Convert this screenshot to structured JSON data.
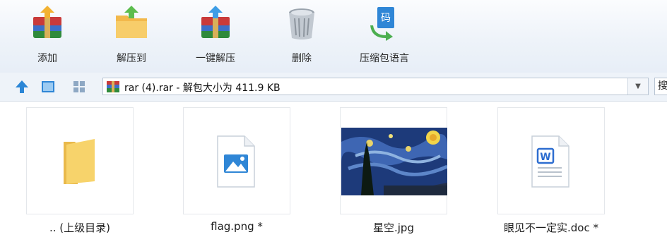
{
  "toolbar": {
    "buttons": [
      {
        "label": "添加",
        "icon": "add-archive-icon"
      },
      {
        "label": "解压到",
        "icon": "extract-folder-icon"
      },
      {
        "label": "一键解压",
        "icon": "one-click-extract-icon"
      },
      {
        "label": "删除",
        "icon": "trash-icon"
      },
      {
        "label": "压缩包语言",
        "icon": "archive-language-icon"
      }
    ]
  },
  "navbar": {
    "path": "rar (4).rar - 解包大小为 411.9 KB",
    "search_partial": "搜"
  },
  "files": [
    {
      "name": ".. (上级目录)",
      "type": "parent-folder"
    },
    {
      "name": "flag.png *",
      "type": "png"
    },
    {
      "name": "星空.jpg",
      "type": "jpg"
    },
    {
      "name": "眼见不一定实.doc *",
      "type": "doc"
    }
  ],
  "colors": {
    "toolbar_bg": "#eef3f9",
    "folder": "#f7d36b",
    "image_icon_blue": "#2f86d6",
    "word_blue": "#2d6dd0"
  }
}
